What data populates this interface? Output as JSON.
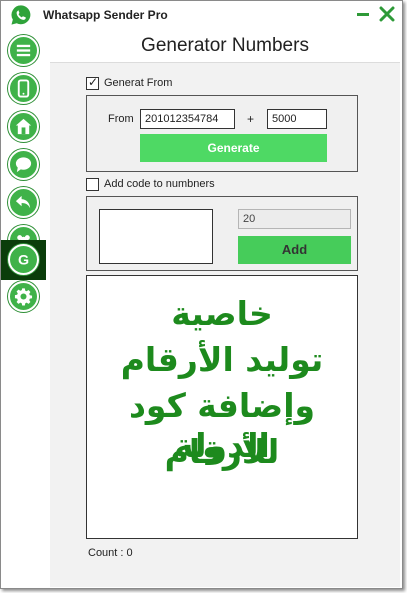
{
  "window": {
    "title": "Whatsapp Sender Pro"
  },
  "icons": {
    "app": "whatsapp-logo",
    "minimize": "minimize-icon",
    "close": "close-icon",
    "nav": [
      "menu-icon",
      "phone-icon",
      "home-icon",
      "chat-icon",
      "back-arrow-icon",
      "group-icon",
      "g-letter-icon",
      "gear-icon"
    ]
  },
  "colors": {
    "accent_green": "#3fb249",
    "button_green": "#4ed964",
    "dark_green": "#0b3d0b",
    "arabic_text": "#1d8a1d"
  },
  "sidebar": {
    "active_index": 6
  },
  "page": {
    "title": "Generator Numbers",
    "generate_from": {
      "checkbox_label": "Generat From",
      "checked": true,
      "from_label": "From",
      "from_value": "201012354784",
      "plus_label": "+",
      "amount_value": "5000",
      "generate_button": "Generate"
    },
    "add_code": {
      "checkbox_label": "Add code to numbners",
      "checked": false,
      "code_value": "20",
      "add_button": "Add"
    },
    "promo_text": [
      "خاصية",
      "توليد الأرقام",
      "وإضافة كود الدولة",
      "للأرقام"
    ],
    "count": {
      "label": "Count : ",
      "value": "0"
    }
  }
}
